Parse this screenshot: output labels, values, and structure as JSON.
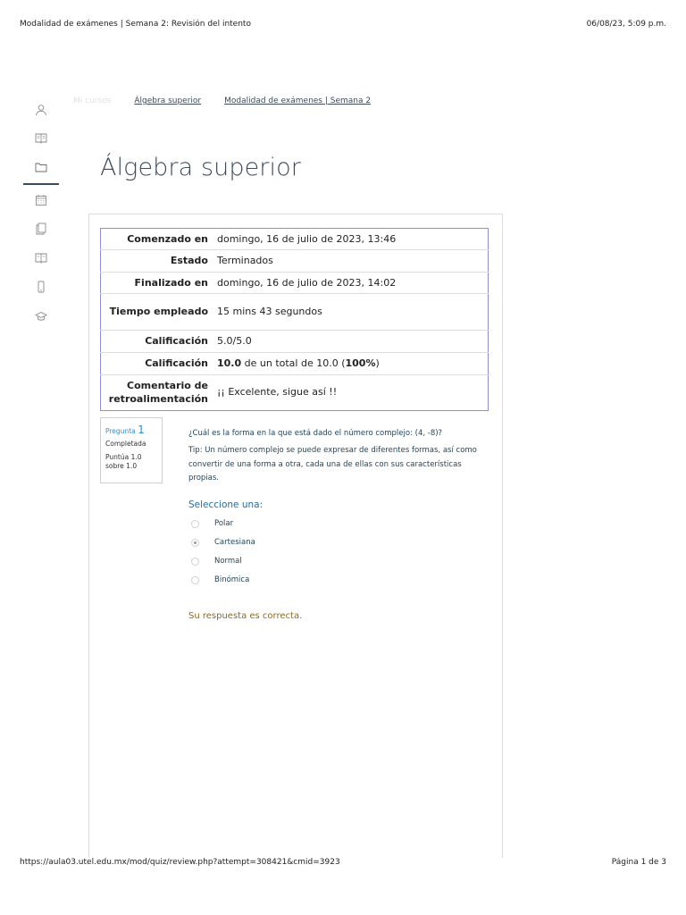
{
  "print": {
    "header_title": "Modalidad de exámenes | Semana 2: Revisión del intento",
    "header_datetime": "06/08/23, 5:09 p.m.",
    "footer_url": "https://aula03.utel.edu.mx/mod/quiz/review.php?attempt=308421&cmid=3923",
    "footer_page": "Página 1 de 3"
  },
  "rail": {
    "items": [
      {
        "icon": "user-icon"
      },
      {
        "icon": "book-icon"
      },
      {
        "icon": "folder-icon",
        "active": true
      },
      {
        "icon": "calendar-icon"
      },
      {
        "icon": "documents-icon"
      },
      {
        "icon": "book-open-icon"
      },
      {
        "icon": "mobile-icon"
      },
      {
        "icon": "graduation-cap-icon"
      }
    ]
  },
  "breadcrumb": {
    "home": "Mi cursos",
    "course": "Álgebra superior",
    "activity": "Modalidad de exámenes | Semana 2"
  },
  "page_title": "Álgebra superior",
  "summary": {
    "rows": [
      {
        "label": "Comenzado en",
        "value": "domingo, 16 de julio de 2023, 13:46"
      },
      {
        "label": "Estado",
        "value": "Terminados"
      },
      {
        "label": "Finalizado en",
        "value": "domingo, 16 de julio de 2023, 14:02"
      },
      {
        "label": "Tiempo empleado",
        "value": "15 mins 43 segundos"
      },
      {
        "label": "Calificación",
        "value": "5.0/5.0"
      },
      {
        "label": "Calificación",
        "value_bold": "10.0",
        "value_mid": " de un total de 10.0 (",
        "value_pct": "100%",
        "value_end": ")"
      },
      {
        "label": "Comentario de retroalimentación",
        "value": "¡¡ Excelente, sigue así !!"
      }
    ]
  },
  "question": {
    "label": "Pregunta",
    "number": "1",
    "state": "Completada",
    "grade": "Puntúa 1.0 sobre 1.0",
    "text": "¿Cuál es la forma en la que está dado el número complejo: (4, -8)?",
    "tip": "Tip: Un número complejo se puede expresar de diferentes formas, así como convertir de una forma a otra, cada una de ellas con sus características propias.",
    "prompt": "Seleccione una:",
    "options": [
      {
        "label": "Polar",
        "selected": false
      },
      {
        "label": "Cartesiana",
        "selected": true
      },
      {
        "label": "Normal",
        "selected": false
      },
      {
        "label": "Binómica",
        "selected": false
      }
    ],
    "feedback": "Su respuesta es correcta."
  },
  "colors": {
    "title": "#3e4b59",
    "table_border": "#8d8dd8",
    "question_text": "#23455a",
    "prompt": "#2a6a98",
    "feedback": "#8a6a25",
    "qnumber": "#3a8ecf"
  }
}
